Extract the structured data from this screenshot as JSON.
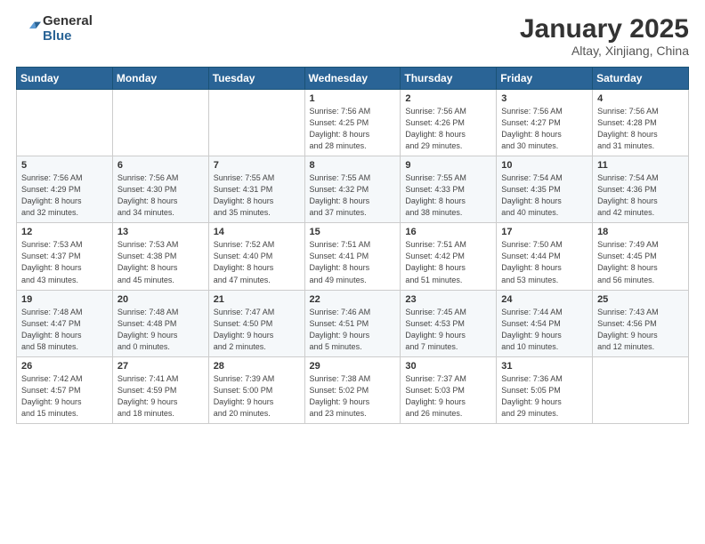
{
  "logo": {
    "general": "General",
    "blue": "Blue"
  },
  "title": {
    "month": "January 2025",
    "location": "Altay, Xinjiang, China"
  },
  "days_header": [
    "Sunday",
    "Monday",
    "Tuesday",
    "Wednesday",
    "Thursday",
    "Friday",
    "Saturday"
  ],
  "weeks": [
    [
      {
        "day": "",
        "info": ""
      },
      {
        "day": "",
        "info": ""
      },
      {
        "day": "",
        "info": ""
      },
      {
        "day": "1",
        "info": "Sunrise: 7:56 AM\nSunset: 4:25 PM\nDaylight: 8 hours\nand 28 minutes."
      },
      {
        "day": "2",
        "info": "Sunrise: 7:56 AM\nSunset: 4:26 PM\nDaylight: 8 hours\nand 29 minutes."
      },
      {
        "day": "3",
        "info": "Sunrise: 7:56 AM\nSunset: 4:27 PM\nDaylight: 8 hours\nand 30 minutes."
      },
      {
        "day": "4",
        "info": "Sunrise: 7:56 AM\nSunset: 4:28 PM\nDaylight: 8 hours\nand 31 minutes."
      }
    ],
    [
      {
        "day": "5",
        "info": "Sunrise: 7:56 AM\nSunset: 4:29 PM\nDaylight: 8 hours\nand 32 minutes."
      },
      {
        "day": "6",
        "info": "Sunrise: 7:56 AM\nSunset: 4:30 PM\nDaylight: 8 hours\nand 34 minutes."
      },
      {
        "day": "7",
        "info": "Sunrise: 7:55 AM\nSunset: 4:31 PM\nDaylight: 8 hours\nand 35 minutes."
      },
      {
        "day": "8",
        "info": "Sunrise: 7:55 AM\nSunset: 4:32 PM\nDaylight: 8 hours\nand 37 minutes."
      },
      {
        "day": "9",
        "info": "Sunrise: 7:55 AM\nSunset: 4:33 PM\nDaylight: 8 hours\nand 38 minutes."
      },
      {
        "day": "10",
        "info": "Sunrise: 7:54 AM\nSunset: 4:35 PM\nDaylight: 8 hours\nand 40 minutes."
      },
      {
        "day": "11",
        "info": "Sunrise: 7:54 AM\nSunset: 4:36 PM\nDaylight: 8 hours\nand 42 minutes."
      }
    ],
    [
      {
        "day": "12",
        "info": "Sunrise: 7:53 AM\nSunset: 4:37 PM\nDaylight: 8 hours\nand 43 minutes."
      },
      {
        "day": "13",
        "info": "Sunrise: 7:53 AM\nSunset: 4:38 PM\nDaylight: 8 hours\nand 45 minutes."
      },
      {
        "day": "14",
        "info": "Sunrise: 7:52 AM\nSunset: 4:40 PM\nDaylight: 8 hours\nand 47 minutes."
      },
      {
        "day": "15",
        "info": "Sunrise: 7:51 AM\nSunset: 4:41 PM\nDaylight: 8 hours\nand 49 minutes."
      },
      {
        "day": "16",
        "info": "Sunrise: 7:51 AM\nSunset: 4:42 PM\nDaylight: 8 hours\nand 51 minutes."
      },
      {
        "day": "17",
        "info": "Sunrise: 7:50 AM\nSunset: 4:44 PM\nDaylight: 8 hours\nand 53 minutes."
      },
      {
        "day": "18",
        "info": "Sunrise: 7:49 AM\nSunset: 4:45 PM\nDaylight: 8 hours\nand 56 minutes."
      }
    ],
    [
      {
        "day": "19",
        "info": "Sunrise: 7:48 AM\nSunset: 4:47 PM\nDaylight: 8 hours\nand 58 minutes."
      },
      {
        "day": "20",
        "info": "Sunrise: 7:48 AM\nSunset: 4:48 PM\nDaylight: 9 hours\nand 0 minutes."
      },
      {
        "day": "21",
        "info": "Sunrise: 7:47 AM\nSunset: 4:50 PM\nDaylight: 9 hours\nand 2 minutes."
      },
      {
        "day": "22",
        "info": "Sunrise: 7:46 AM\nSunset: 4:51 PM\nDaylight: 9 hours\nand 5 minutes."
      },
      {
        "day": "23",
        "info": "Sunrise: 7:45 AM\nSunset: 4:53 PM\nDaylight: 9 hours\nand 7 minutes."
      },
      {
        "day": "24",
        "info": "Sunrise: 7:44 AM\nSunset: 4:54 PM\nDaylight: 9 hours\nand 10 minutes."
      },
      {
        "day": "25",
        "info": "Sunrise: 7:43 AM\nSunset: 4:56 PM\nDaylight: 9 hours\nand 12 minutes."
      }
    ],
    [
      {
        "day": "26",
        "info": "Sunrise: 7:42 AM\nSunset: 4:57 PM\nDaylight: 9 hours\nand 15 minutes."
      },
      {
        "day": "27",
        "info": "Sunrise: 7:41 AM\nSunset: 4:59 PM\nDaylight: 9 hours\nand 18 minutes."
      },
      {
        "day": "28",
        "info": "Sunrise: 7:39 AM\nSunset: 5:00 PM\nDaylight: 9 hours\nand 20 minutes."
      },
      {
        "day": "29",
        "info": "Sunrise: 7:38 AM\nSunset: 5:02 PM\nDaylight: 9 hours\nand 23 minutes."
      },
      {
        "day": "30",
        "info": "Sunrise: 7:37 AM\nSunset: 5:03 PM\nDaylight: 9 hours\nand 26 minutes."
      },
      {
        "day": "31",
        "info": "Sunrise: 7:36 AM\nSunset: 5:05 PM\nDaylight: 9 hours\nand 29 minutes."
      },
      {
        "day": "",
        "info": ""
      }
    ]
  ]
}
